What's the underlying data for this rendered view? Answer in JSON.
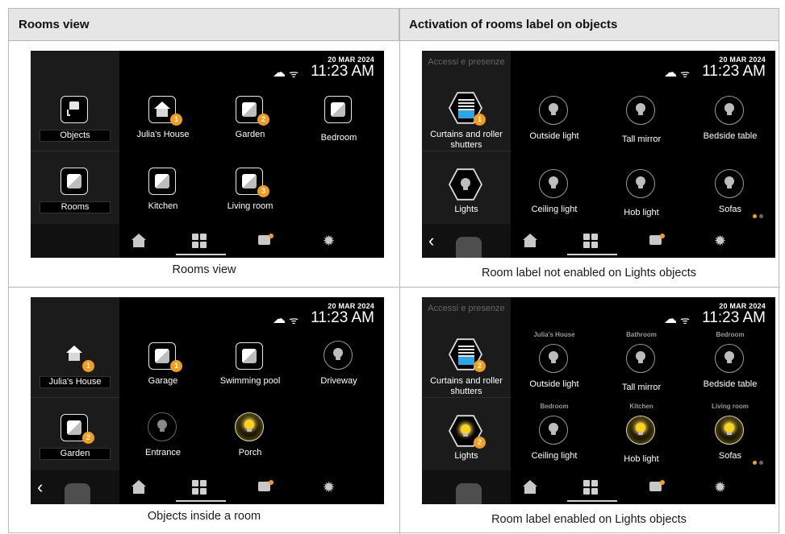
{
  "headers": {
    "left": "Rooms view",
    "right": "Activation of rooms label on objects"
  },
  "status": {
    "date": "20 MAR 2024",
    "time": "11:23 AM"
  },
  "colors": {
    "badge": "#f29d1e",
    "screen_bg": "#000000",
    "sidebar_bg": "#1b1b1b",
    "bulb_on": "#ffd21a",
    "blind": "#29a7e8"
  },
  "nav": {
    "icons": [
      "home-icon",
      "grid-icon",
      "chat-icon",
      "gear-icon"
    ]
  },
  "panel1": {
    "caption": "Rooms view",
    "sidebar": [
      {
        "label": "Objects",
        "icon": "lamp-icon"
      },
      {
        "label": "Rooms",
        "icon": "room-icon"
      }
    ],
    "tiles": [
      {
        "label": "Julia's House",
        "badge": "1",
        "icon": "house-icon"
      },
      {
        "label": "Garden",
        "badge": "2",
        "icon": "room-icon"
      },
      {
        "label": "Bedroom",
        "icon": "room-icon"
      },
      {
        "label": "Kitchen",
        "icon": "room-icon"
      },
      {
        "label": "Living room",
        "badge": "3",
        "icon": "room-icon"
      }
    ]
  },
  "panel2": {
    "caption": "Room label not enabled on Lights objects",
    "sidebar_top": "Accessi e presenze",
    "sidebar": [
      {
        "label": "Curtains and roller shutters",
        "badge": "1",
        "icon": "blind-icon"
      },
      {
        "label": "Lights",
        "icon": "bulb-icon"
      }
    ],
    "tiles": [
      {
        "label": "Outside light"
      },
      {
        "label": "Tall mirror"
      },
      {
        "label": "Bedside table"
      },
      {
        "label": "Ceiling light"
      },
      {
        "label": "Hob light"
      },
      {
        "label": "Sofas"
      }
    ]
  },
  "panel3": {
    "caption": "Objects inside a room",
    "sidebar": [
      {
        "label": "Julia's House",
        "badge": "1",
        "icon": "house-icon"
      },
      {
        "label": "Garden",
        "badge": "2",
        "icon": "room-icon"
      }
    ],
    "tiles": [
      {
        "label": "Garage",
        "badge": "1",
        "icon": "room-icon"
      },
      {
        "label": "Swimming pool",
        "icon": "room-icon"
      },
      {
        "label": "Driveway",
        "icon": "bulb-icon"
      },
      {
        "label": "Entrance",
        "icon": "bulb-icon"
      },
      {
        "label": "Porch",
        "icon": "bulb-icon",
        "on": true
      }
    ]
  },
  "panel4": {
    "caption": "Room label enabled on Lights objects",
    "sidebar_top": "Accessi e presenze",
    "sidebar": [
      {
        "label": "Curtains and roller shutters",
        "badge": "2",
        "icon": "blind-icon"
      },
      {
        "label": "Lights",
        "badge": "2",
        "icon": "bulb-icon",
        "on": true
      }
    ],
    "tiles": [
      {
        "label": "Outside light",
        "room": "Julia's House"
      },
      {
        "label": "Tall mirror",
        "room": "Bathroom"
      },
      {
        "label": "Bedside table",
        "room": "Bedroom"
      },
      {
        "label": "Ceiling light",
        "room": "Bedroom"
      },
      {
        "label": "Hob light",
        "room": "Kitchen",
        "on": true
      },
      {
        "label": "Sofas",
        "room": "Living room",
        "on": true
      }
    ]
  }
}
